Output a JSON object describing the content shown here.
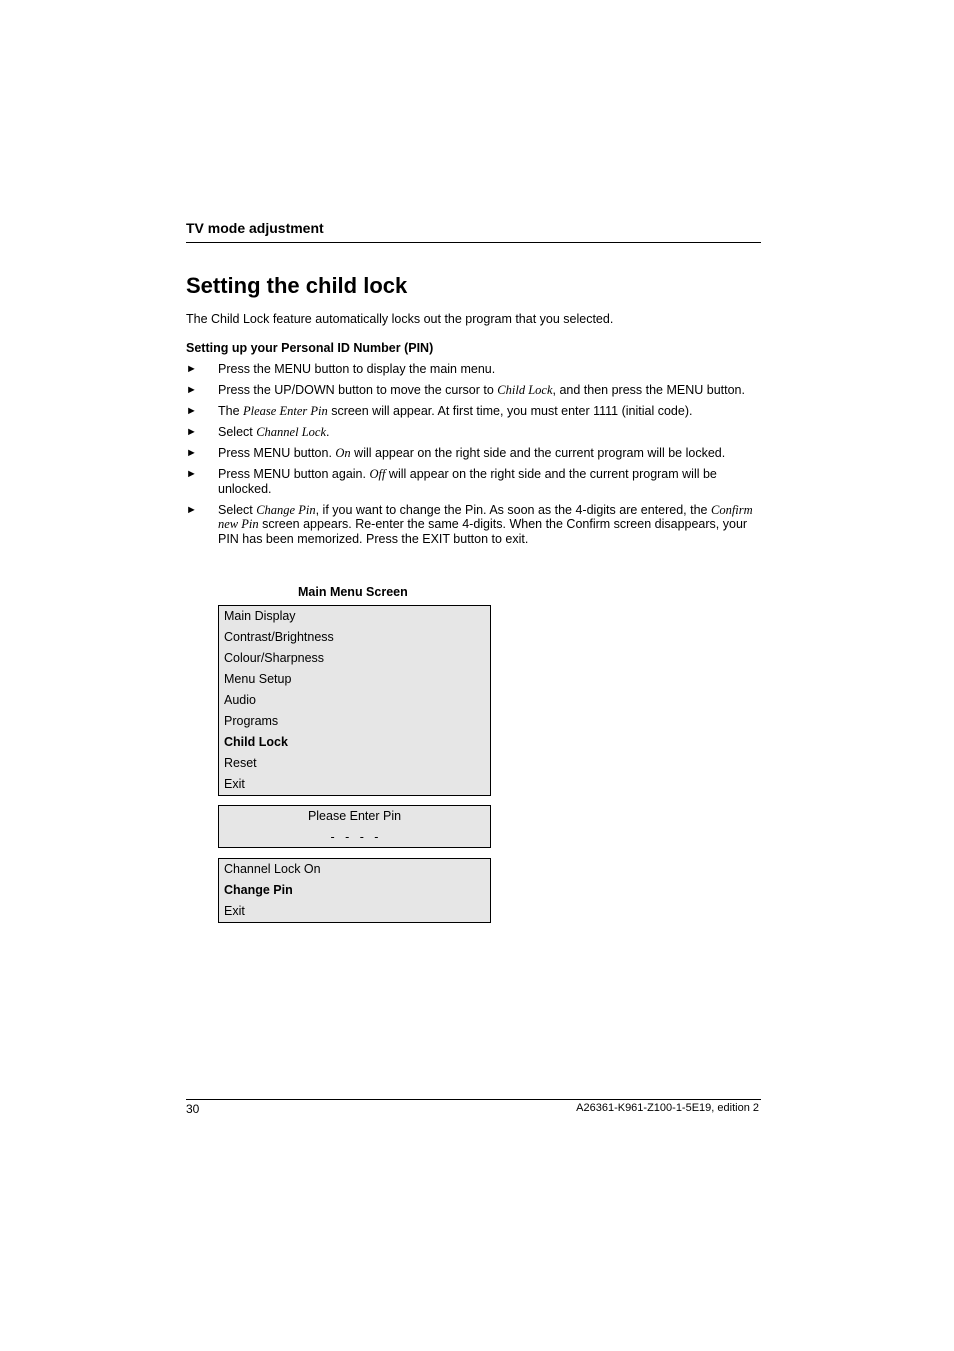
{
  "header": {
    "section_title": "TV mode adjustment"
  },
  "main": {
    "title": "Setting the child lock",
    "intro": "The Child Lock feature automatically locks out the program that you selected.",
    "subheading": "Setting up your Personal ID Number (PIN)",
    "bullet_glyph": "►",
    "steps": [
      {
        "parts": [
          {
            "t": "Press the MENU button to display the main menu."
          }
        ]
      },
      {
        "parts": [
          {
            "t": "Press the UP/DOWN button to move the cursor to "
          },
          {
            "t": "Child Lock",
            "i": true
          },
          {
            "t": ", and then press the MENU button."
          }
        ]
      },
      {
        "parts": [
          {
            "t": "The "
          },
          {
            "t": "Please Enter Pin",
            "i": true
          },
          {
            "t": " screen will appear. At first time, you must enter 1111 (initial code)."
          }
        ]
      },
      {
        "parts": [
          {
            "t": "Select "
          },
          {
            "t": "Channel Lock",
            "i": true
          },
          {
            "t": "."
          }
        ]
      },
      {
        "parts": [
          {
            "t": "Press MENU button. "
          },
          {
            "t": "On",
            "i": true
          },
          {
            "t": " will appear on the right side and the current program will be locked."
          }
        ]
      },
      {
        "parts": [
          {
            "t": "Press MENU button again. "
          },
          {
            "t": "Off",
            "i": true
          },
          {
            "t": " will appear on the right side and the current program will be unlocked."
          }
        ]
      },
      {
        "parts": [
          {
            "t": "Select "
          },
          {
            "t": "Change Pin",
            "i": true
          },
          {
            "t": ", if you want to change the Pin. As soon as the 4-digits are entered, the "
          },
          {
            "t": "Confirm new Pin",
            "i": true
          },
          {
            "t": " screen appears. Re-enter the same 4-digits. When the Confirm screen disappears, your PIN has been memorized. Press the EXIT button to exit."
          }
        ]
      }
    ]
  },
  "figure": {
    "caption": "Main Menu Screen",
    "main_menu": [
      {
        "label": "Main Display",
        "bold": false
      },
      {
        "label": "Contrast/Brightness",
        "bold": false
      },
      {
        "label": "Colour/Sharpness",
        "bold": false
      },
      {
        "label": "Menu Setup",
        "bold": false
      },
      {
        "label": "Audio",
        "bold": false
      },
      {
        "label": "Programs",
        "bold": false
      },
      {
        "label": "Child Lock",
        "bold": true
      },
      {
        "label": "Reset",
        "bold": false
      },
      {
        "label": "Exit",
        "bold": false
      }
    ],
    "pin_screen": {
      "prompt": "Please Enter Pin",
      "placeholder": "-   -   -   -"
    },
    "lock_menu": [
      {
        "label": "Channel Lock On",
        "bold": false
      },
      {
        "label": "Change Pin",
        "bold": true
      },
      {
        "label": "Exit",
        "bold": false
      }
    ],
    "panel_bg": "#e6e6e6"
  },
  "footer": {
    "page_number": "30",
    "document_id": "A26361-K961-Z100-1-5E19, edition 2"
  }
}
